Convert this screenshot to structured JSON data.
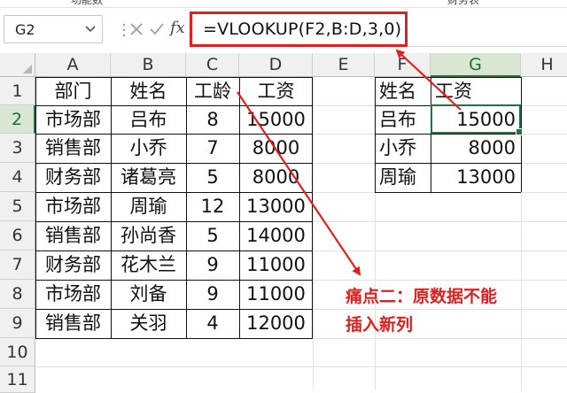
{
  "toolbar_fragments": [
    "功能数",
    "财务表"
  ],
  "name_box": {
    "value": "G2"
  },
  "formula_bar": {
    "fx_label": "fx",
    "formula": "=VLOOKUP(F2,B:D,3,0)"
  },
  "columns": [
    "A",
    "B",
    "C",
    "D",
    "E",
    "F",
    "G",
    "H"
  ],
  "rows": [
    "1",
    "2",
    "3",
    "4",
    "5",
    "6",
    "7",
    "8",
    "9",
    "10",
    "11"
  ],
  "source_table": {
    "headers": [
      "部门",
      "姓名",
      "工龄",
      "工资"
    ],
    "rows": [
      [
        "市场部",
        "吕布",
        "8",
        "15000"
      ],
      [
        "销售部",
        "小乔",
        "7",
        "8000"
      ],
      [
        "财务部",
        "诸葛亮",
        "5",
        "8000"
      ],
      [
        "市场部",
        "周瑜",
        "12",
        "13000"
      ],
      [
        "销售部",
        "孙尚香",
        "5",
        "14000"
      ],
      [
        "财务部",
        "花木兰",
        "9",
        "11000"
      ],
      [
        "市场部",
        "刘备",
        "9",
        "11000"
      ],
      [
        "销售部",
        "关羽",
        "4",
        "12000"
      ]
    ]
  },
  "lookup_table": {
    "headers": [
      "姓名",
      "工资"
    ],
    "rows": [
      [
        "吕布",
        "15000"
      ],
      [
        "小乔",
        "8000"
      ],
      [
        "周瑜",
        "13000"
      ]
    ]
  },
  "annotation": {
    "line1": "痛点二：原数据不能",
    "line2": "插入新列"
  },
  "colors": {
    "accent_red": "#e02020",
    "excel_green": "#217346"
  },
  "active_cell": "G2"
}
